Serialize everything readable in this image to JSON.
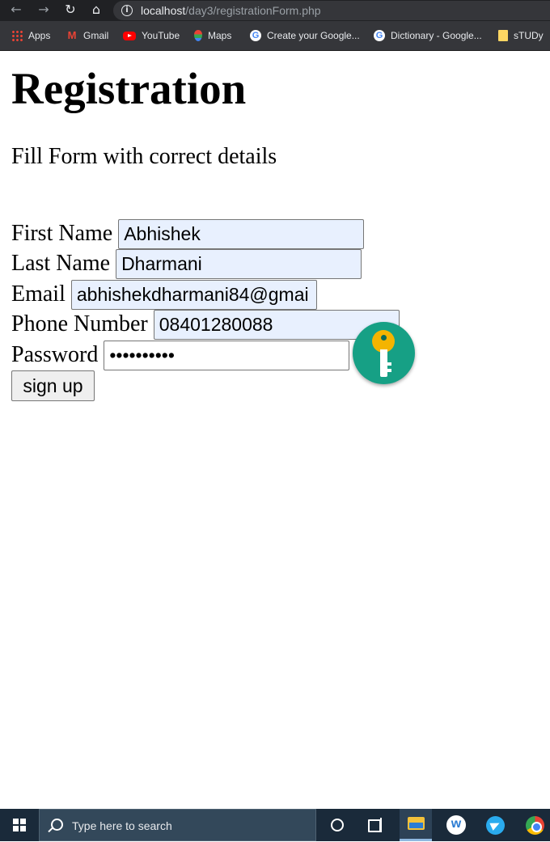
{
  "browser": {
    "url_host": "localhost",
    "url_path": "/day3/registrationForm.php",
    "bookmarks": [
      {
        "label": "Apps",
        "icon": "apps-grid-icon"
      },
      {
        "label": "Gmail",
        "icon": "gmail-icon"
      },
      {
        "label": "YouTube",
        "icon": "youtube-icon"
      },
      {
        "label": "Maps",
        "icon": "maps-icon"
      },
      {
        "label": "Create your Google...",
        "icon": "google-icon"
      },
      {
        "label": "Dictionary - Google...",
        "icon": "google-icon"
      },
      {
        "label": "sTUDy",
        "icon": "folder-icon"
      }
    ]
  },
  "page": {
    "title": "Registration",
    "subtitle": "Fill Form with correct details",
    "fields": [
      {
        "label": "First Name",
        "value": "Abhishek"
      },
      {
        "label": "Last Name",
        "value": "Dharmani"
      },
      {
        "label": "Email",
        "value": "abhishekdharmani84@gmai"
      },
      {
        "label": "Phone Number",
        "value": "08401280088"
      },
      {
        "label": "Password",
        "value": "••••••••••"
      }
    ],
    "submit_label": "sign up"
  },
  "taskbar": {
    "search_placeholder": "Type here to search"
  },
  "colors": {
    "autofill_bg": "#e8f0fe",
    "key_button_bg": "#16a085",
    "taskbar_bg": "#1a2a3a"
  }
}
